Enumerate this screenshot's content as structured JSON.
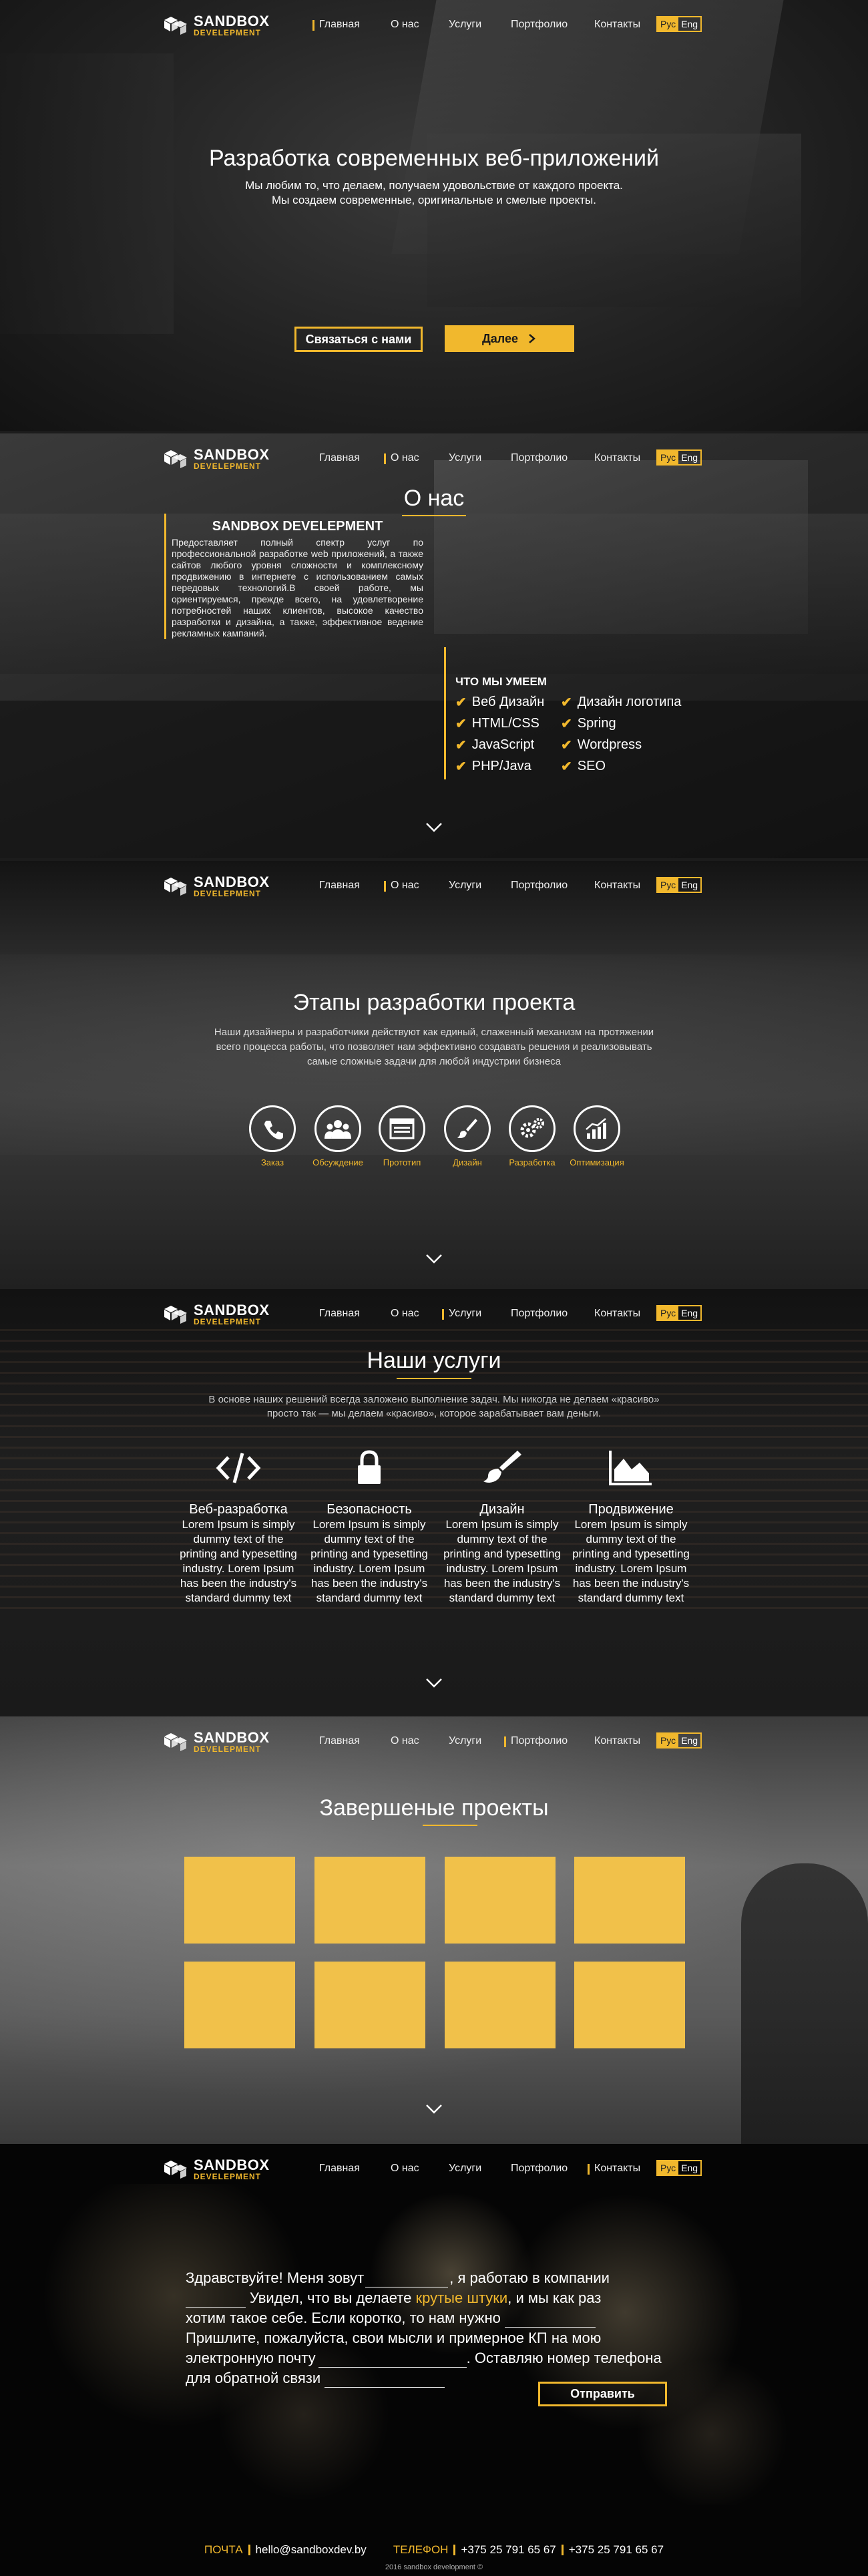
{
  "nav": {
    "logo_top": "SANDBOX",
    "logo_bottom": "DEVELEPMENT",
    "items": [
      "Главная",
      "О нас",
      "Услуги",
      "Портфолио",
      "Контакты"
    ],
    "lang_ru": "Рус",
    "lang_en": "Eng"
  },
  "hero": {
    "title": "Разработка современных веб-приложений",
    "line1": "Мы любим то, что делаем, получаем удовольствие от каждого проекта.",
    "line2": "Мы создаем современные, оригинальные и смелые проекты.",
    "contact_button": "Связаться с нами",
    "next_button": "Далее"
  },
  "about": {
    "title": "О нас",
    "company": "SANDBOX DEVELEPMENT",
    "text": "Предоставляет полный спектр услуг по профессиональной разработке web приложений, а также сайтов любого уровня сложности и комплексному продвижению в интернете с использованием самых передовых технологий.В своей работе, мы ориентируемся, прежде всего, на удовлетворение потребностей наших клиентов, высокое качество разработки и дизайна, а также, эффективное ведение рекламных кампаний.",
    "skills_title": "ЧТО МЫ УМЕЕМ",
    "skills_left": [
      "Веб Дизайн",
      "HTML/CSS",
      "JavaScript",
      "PHP/Java"
    ],
    "skills_right": [
      "Дизайн логотипа",
      "Spring",
      "Wordpress",
      "SEO"
    ]
  },
  "stages": {
    "title": "Этапы разработки проекта",
    "text1": "Наши дизайнеры и разработчики действуют как единый, слаженный механизм на протяжении",
    "text2": "всего процесса работы, что позволяет нам эффективно создавать решения и реализовывать",
    "text3": "самые сложные задачи для любой индустрии бизнеса",
    "steps": [
      "Заказ",
      "Обсуждение",
      "Прототип",
      "Дизайн",
      "Разработка",
      "Оптимизация"
    ]
  },
  "services": {
    "title": "Наши услуги",
    "text1": "В основе наших решений всегда заложено выполнение задач. Мы никогда не делаем «красиво»",
    "text2": "просто так — мы делаем «красиво», которое зарабатывает вам деньги.",
    "items": [
      {
        "title": "Веб-разработка",
        "text": "Lorem Ipsum is simply dummy text of the printing and typesetting industry. Lorem Ipsum has been the industry's standard dummy text",
        "icon": "code-icon"
      },
      {
        "title": "Безопасность",
        "text": "Lorem Ipsum is simply dummy text of the printing and typesetting industry. Lorem Ipsum has been the industry's standard dummy text",
        "icon": "lock-icon"
      },
      {
        "title": "Дизайн",
        "text": "Lorem Ipsum is simply dummy text of the printing and typesetting industry. Lorem Ipsum has been the industry's standard dummy text",
        "icon": "brush-icon"
      },
      {
        "title": "Продвижение",
        "text": "Lorem Ipsum is simply dummy text of the printing and typesetting industry. Lorem Ipsum has been the industry's standard dummy text",
        "icon": "chart-icon"
      }
    ]
  },
  "projects": {
    "title": "Завершеные проекты"
  },
  "contact": {
    "line1a": "Здравствуйте! Меня зовут",
    "line1b": ", я работаю в компании",
    "line2a": "Увидел, что вы делаете",
    "line2b": "крутые штуки",
    "line2c": ", и мы как раз",
    "line3": "хотим такое себе. Если коротко, то нам нужно",
    "line4": "Пришлите, пожалуйста, свои мысли и примерное КП на мою",
    "line5a": "электронную почту",
    "line5b": ". Оставляю номер телефона",
    "line6": "для обратной связи",
    "send_button": "Отправить"
  },
  "footer": {
    "mail_label": "ПОЧТА",
    "mail": "hello@sandboxdev.by",
    "phone_label": "ТЕЛЕФОН",
    "phone1": "+375 25 791 65 67",
    "phone2": "+375 25 791 65 67",
    "copyright": "2016 sandbox development ©"
  },
  "colors": {
    "accent": "#f1b82d",
    "project_tile": "#f1c14a"
  }
}
